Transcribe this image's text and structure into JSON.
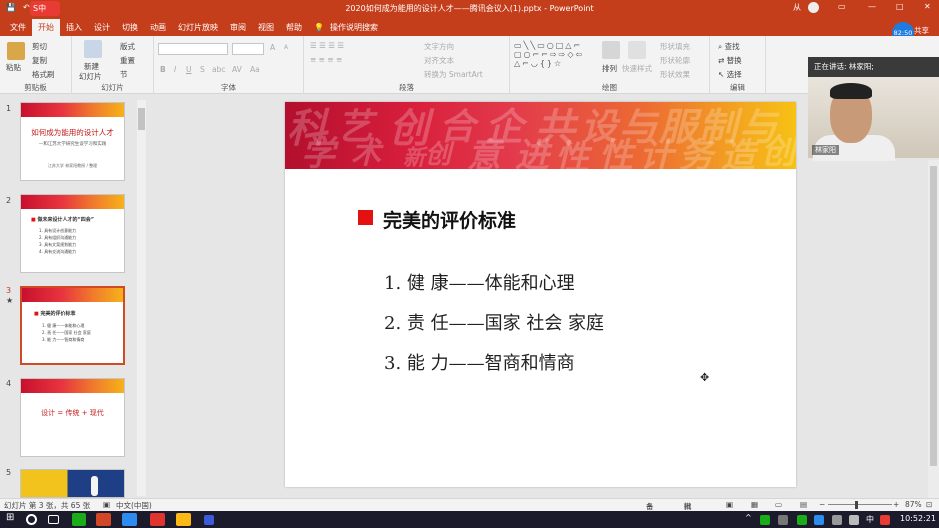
{
  "window": {
    "title": "2020如何成为能用的设计人才——腾讯会议入(1).pptx - PowerPoint",
    "user": "从",
    "ctrl_min": "—",
    "ctrl_max": "□",
    "ctrl_close": "✕",
    "ctrl_restore": "▭"
  },
  "qat": {
    "save": "💾",
    "undo": "↶",
    "redo": "↷"
  },
  "ime": {
    "label": "S中"
  },
  "tabs": [
    "文件",
    "开始",
    "插入",
    "设计",
    "切换",
    "动画",
    "幻灯片放映",
    "审阅",
    "视图",
    "帮助"
  ],
  "tell_me": "操作说明搜索",
  "share": {
    "label": "共享",
    "badge": "82:50"
  },
  "ribbon": {
    "clipboard": {
      "label": "剪贴板",
      "paste": "粘贴",
      "cut": "剪切",
      "copy": "复制",
      "format_painter": "格式刷"
    },
    "slides": {
      "label": "幻灯片",
      "new": "新建",
      "new2": "幻灯片",
      "layout": "版式",
      "reset": "重置",
      "section": "节"
    },
    "font": {
      "label": "字体",
      "bold": "B",
      "italic": "I",
      "underline": "U",
      "strike": "S",
      "shadow": "abc",
      "spacing": "AV",
      "case": "Aa",
      "grow": "A",
      "shrink": "A"
    },
    "paragraph": {
      "label": "段落",
      "dir": "文字方向",
      "align": "对齐文本",
      "smartart": "转换为 SmartArt"
    },
    "drawing": {
      "label": "绘图",
      "arrange": "排列",
      "quick": "快速样式",
      "fill": "形状填充",
      "outline": "形状轮廓",
      "effect": "形状效果"
    },
    "editing": {
      "label": "编辑",
      "find": "查找",
      "replace": "替换",
      "select": "选择"
    }
  },
  "thumbnails": [
    {
      "num": "1",
      "title": "如何成为能用的设计人才",
      "sub": "—和江苏大学研究生谈学习和实践",
      "foot": "江苏大学 林家阳教授 / 整理"
    },
    {
      "num": "2",
      "title": "做未来设计人才的“四会”",
      "lines": [
        "1. 具有设计创意能力",
        "2. 具有组织沟通能力",
        "3. 具有文案规划能力",
        "4. 具有交流沟通能力"
      ]
    },
    {
      "num": "3",
      "title": "完美的评价标准",
      "lines": [
        "1. 健 康——体能和心理",
        "2. 责 任——国家 社会 家庭",
        "3. 能 力——智商和情商"
      ]
    },
    {
      "num": "4",
      "title": "设计 = 传统 + 现代"
    },
    {
      "num": "5"
    }
  ],
  "slide": {
    "header_chars": [
      "科",
      "学",
      "艺",
      "术",
      "创",
      "新",
      "合",
      "企",
      "共",
      "意",
      "进",
      "设",
      "与",
      "性",
      "计",
      "服",
      "务",
      "制",
      "造",
      "与",
      "设",
      "创"
    ],
    "title": "完美的评价标准",
    "items": [
      "1. 健  康——体能和心理",
      "2. 责  任——国家  社会  家庭",
      "3. 能  力——智商和情商"
    ]
  },
  "video": {
    "speaking": "正在讲话: 林家阳;",
    "name": "林家阳"
  },
  "status": {
    "slide_info": "幻灯片 第 3 张，共 65 张",
    "lang": "中文(中国)",
    "notes": "备注",
    "comments": "批注",
    "zoom": "87%",
    "minus": "−",
    "plus": "+"
  },
  "taskbar": {
    "time": "10:52:21",
    "ime": "中"
  }
}
